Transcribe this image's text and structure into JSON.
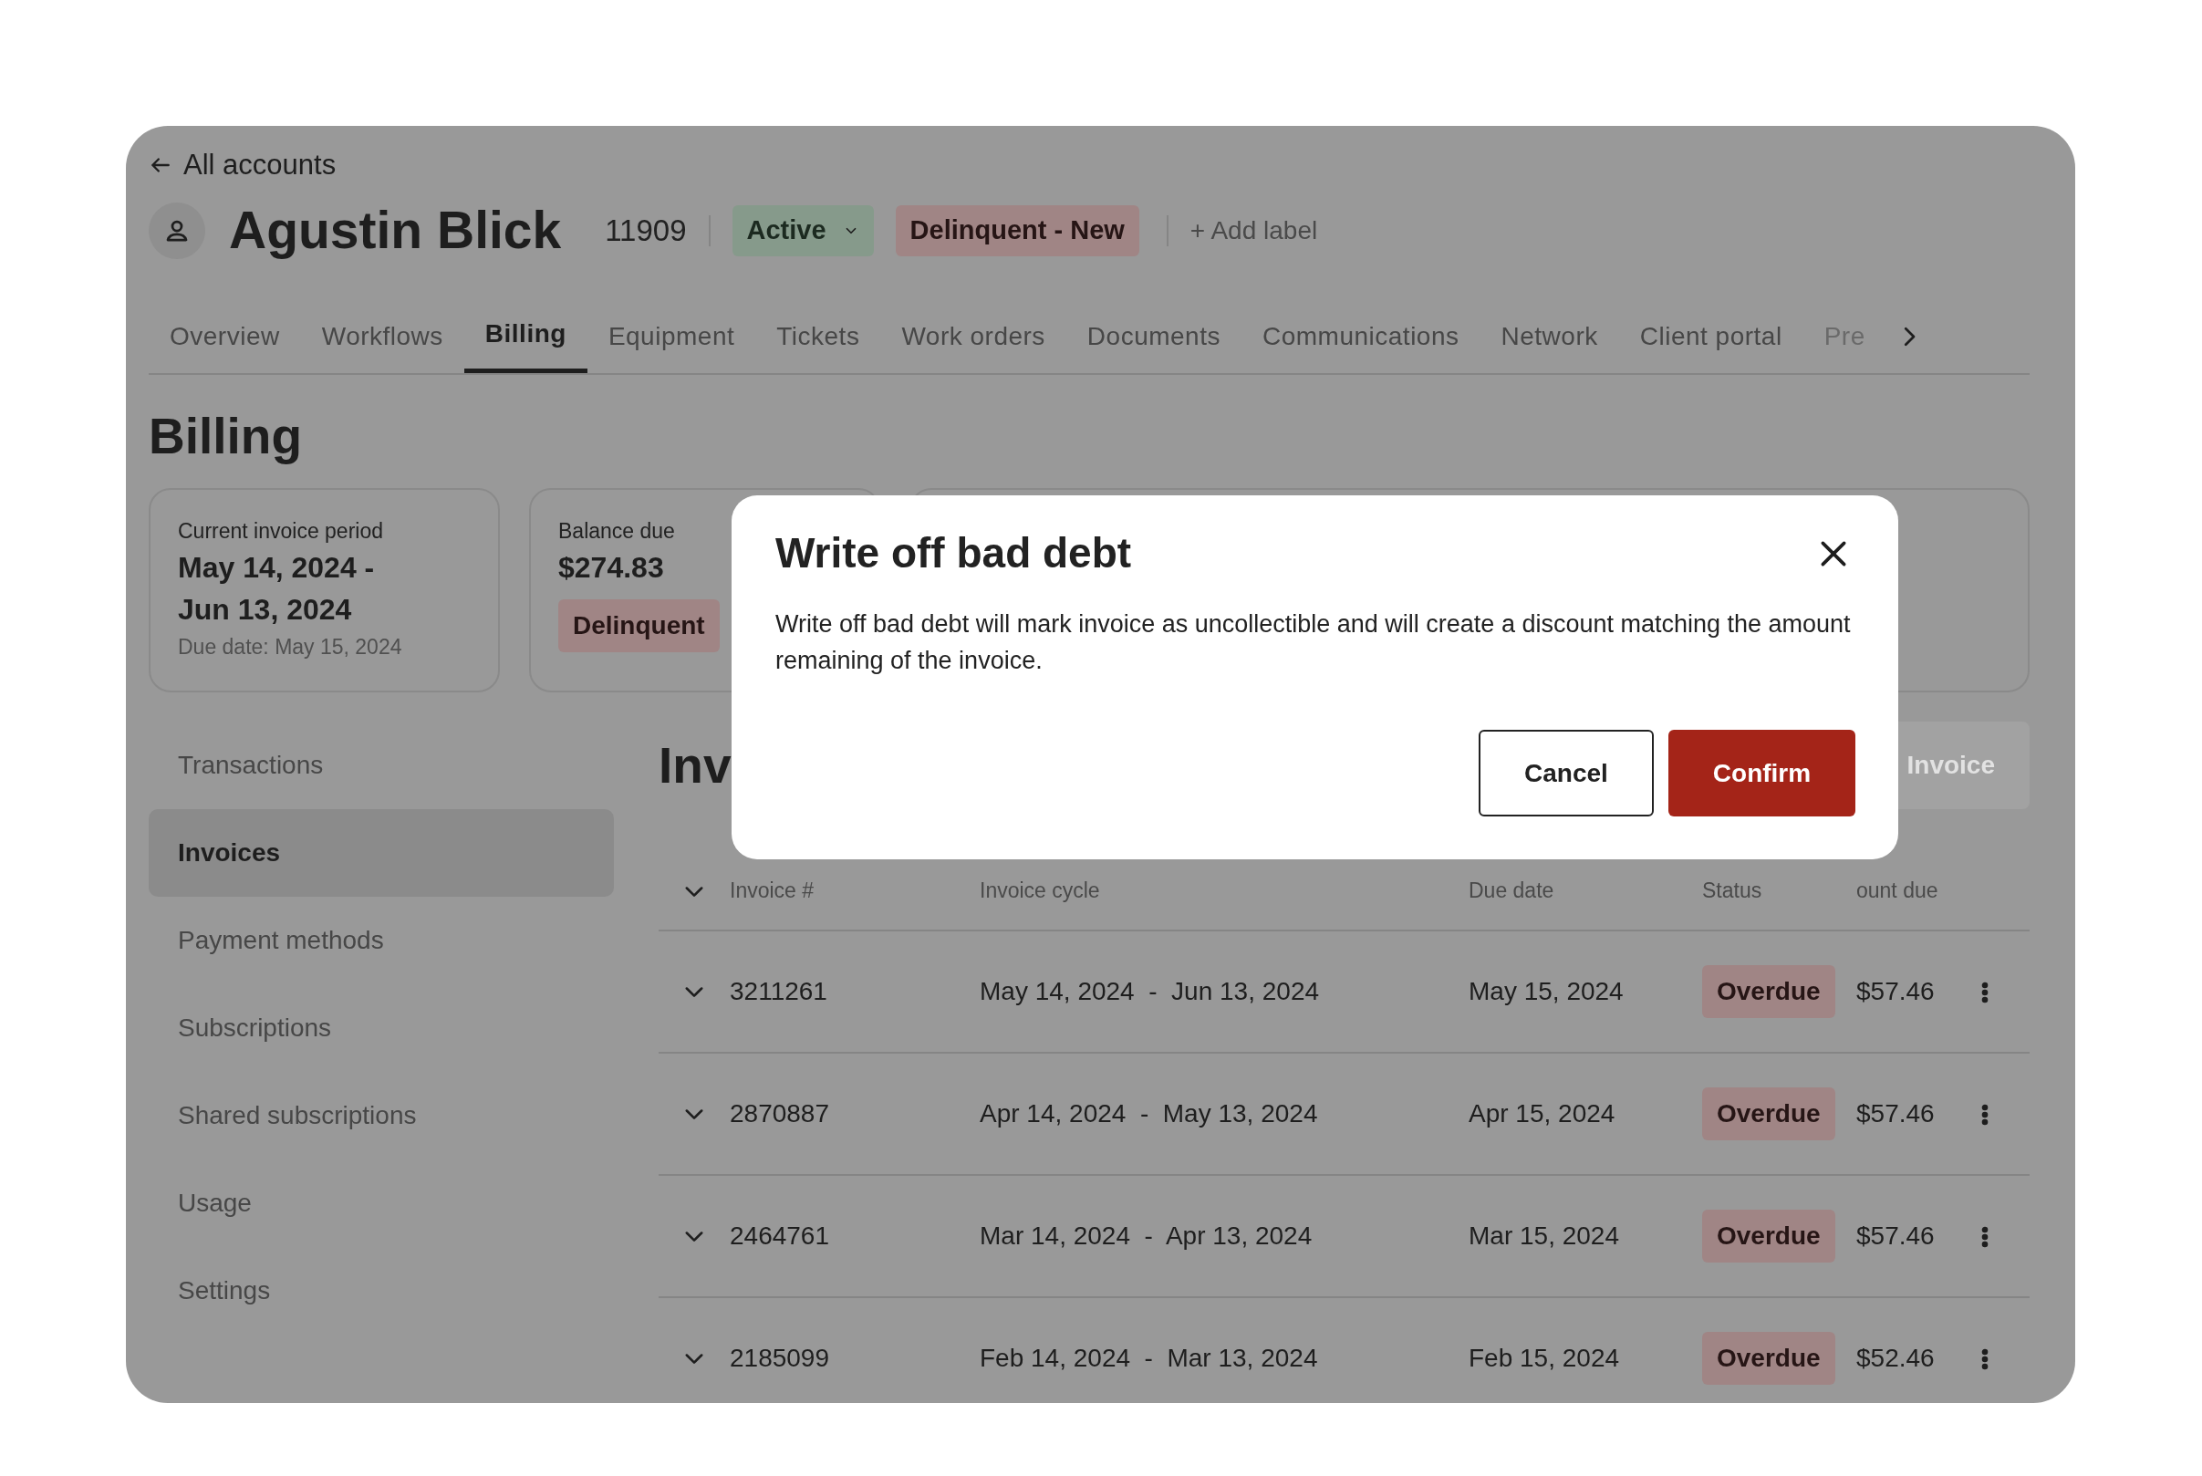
{
  "back_link": {
    "label": "All accounts"
  },
  "account": {
    "name": "Agustin Blick",
    "id": "11909",
    "status": "Active",
    "labels": [
      "Delinquent - New"
    ],
    "add_label": "+ Add label"
  },
  "tabs": [
    {
      "label": "Overview",
      "selected": false
    },
    {
      "label": "Workflows",
      "selected": false
    },
    {
      "label": "Billing",
      "selected": true
    },
    {
      "label": "Equipment",
      "selected": false
    },
    {
      "label": "Tickets",
      "selected": false
    },
    {
      "label": "Work orders",
      "selected": false
    },
    {
      "label": "Documents",
      "selected": false
    },
    {
      "label": "Communications",
      "selected": false
    },
    {
      "label": "Network",
      "selected": false
    },
    {
      "label": "Client portal",
      "selected": false
    },
    {
      "label": "Pre",
      "selected": false
    }
  ],
  "page_title": "Billing",
  "summary_cards": [
    {
      "kind": "period",
      "label": "Current invoice period",
      "value": "May 14, 2024  -  Jun 13, 2024",
      "note": "Due date: May 15, 2024"
    },
    {
      "kind": "balance",
      "label": "Balance due",
      "value": "$274.83",
      "badge": "Delinquent"
    },
    {
      "kind": "blank"
    }
  ],
  "sidebar": {
    "items": [
      {
        "label": "Transactions",
        "selected": false
      },
      {
        "label": "Invoices",
        "selected": true
      },
      {
        "label": "Payment methods",
        "selected": false
      },
      {
        "label": "Subscriptions",
        "selected": false
      },
      {
        "label": "Shared subscriptions",
        "selected": false
      },
      {
        "label": "Usage",
        "selected": false
      },
      {
        "label": "Settings",
        "selected": false
      }
    ]
  },
  "invoices": {
    "title": "Inv",
    "action": "Invoice",
    "columns": [
      "Invoice #",
      "Invoice cycle",
      "Due date",
      "Status",
      "ount due"
    ],
    "rows": [
      {
        "invoice": "3211261",
        "cycle": "May 14, 2024  -  Jun 13, 2024",
        "due": "May 15, 2024",
        "status": "Overdue",
        "amount": "$57.46"
      },
      {
        "invoice": "2870887",
        "cycle": "Apr 14, 2024  -  May 13, 2024",
        "due": "Apr 15, 2024",
        "status": "Overdue",
        "amount": "$57.46"
      },
      {
        "invoice": "2464761",
        "cycle": "Mar 14, 2024  -  Apr 13, 2024",
        "due": "Mar 15, 2024",
        "status": "Overdue",
        "amount": "$57.46"
      },
      {
        "invoice": "2185099",
        "cycle": "Feb 14, 2024  -  Mar 13, 2024",
        "due": "Feb 15, 2024",
        "status": "Overdue",
        "amount": "$52.46"
      }
    ]
  },
  "modal": {
    "title": "Write off bad debt",
    "body": "Write off bad debt will mark invoice as uncollectible and will create a discount matching the amount remaining of the invoice.",
    "buttons": [
      {
        "label": "Cancel",
        "kind": "secondary"
      },
      {
        "label": "Confirm",
        "kind": "primary"
      }
    ]
  }
}
